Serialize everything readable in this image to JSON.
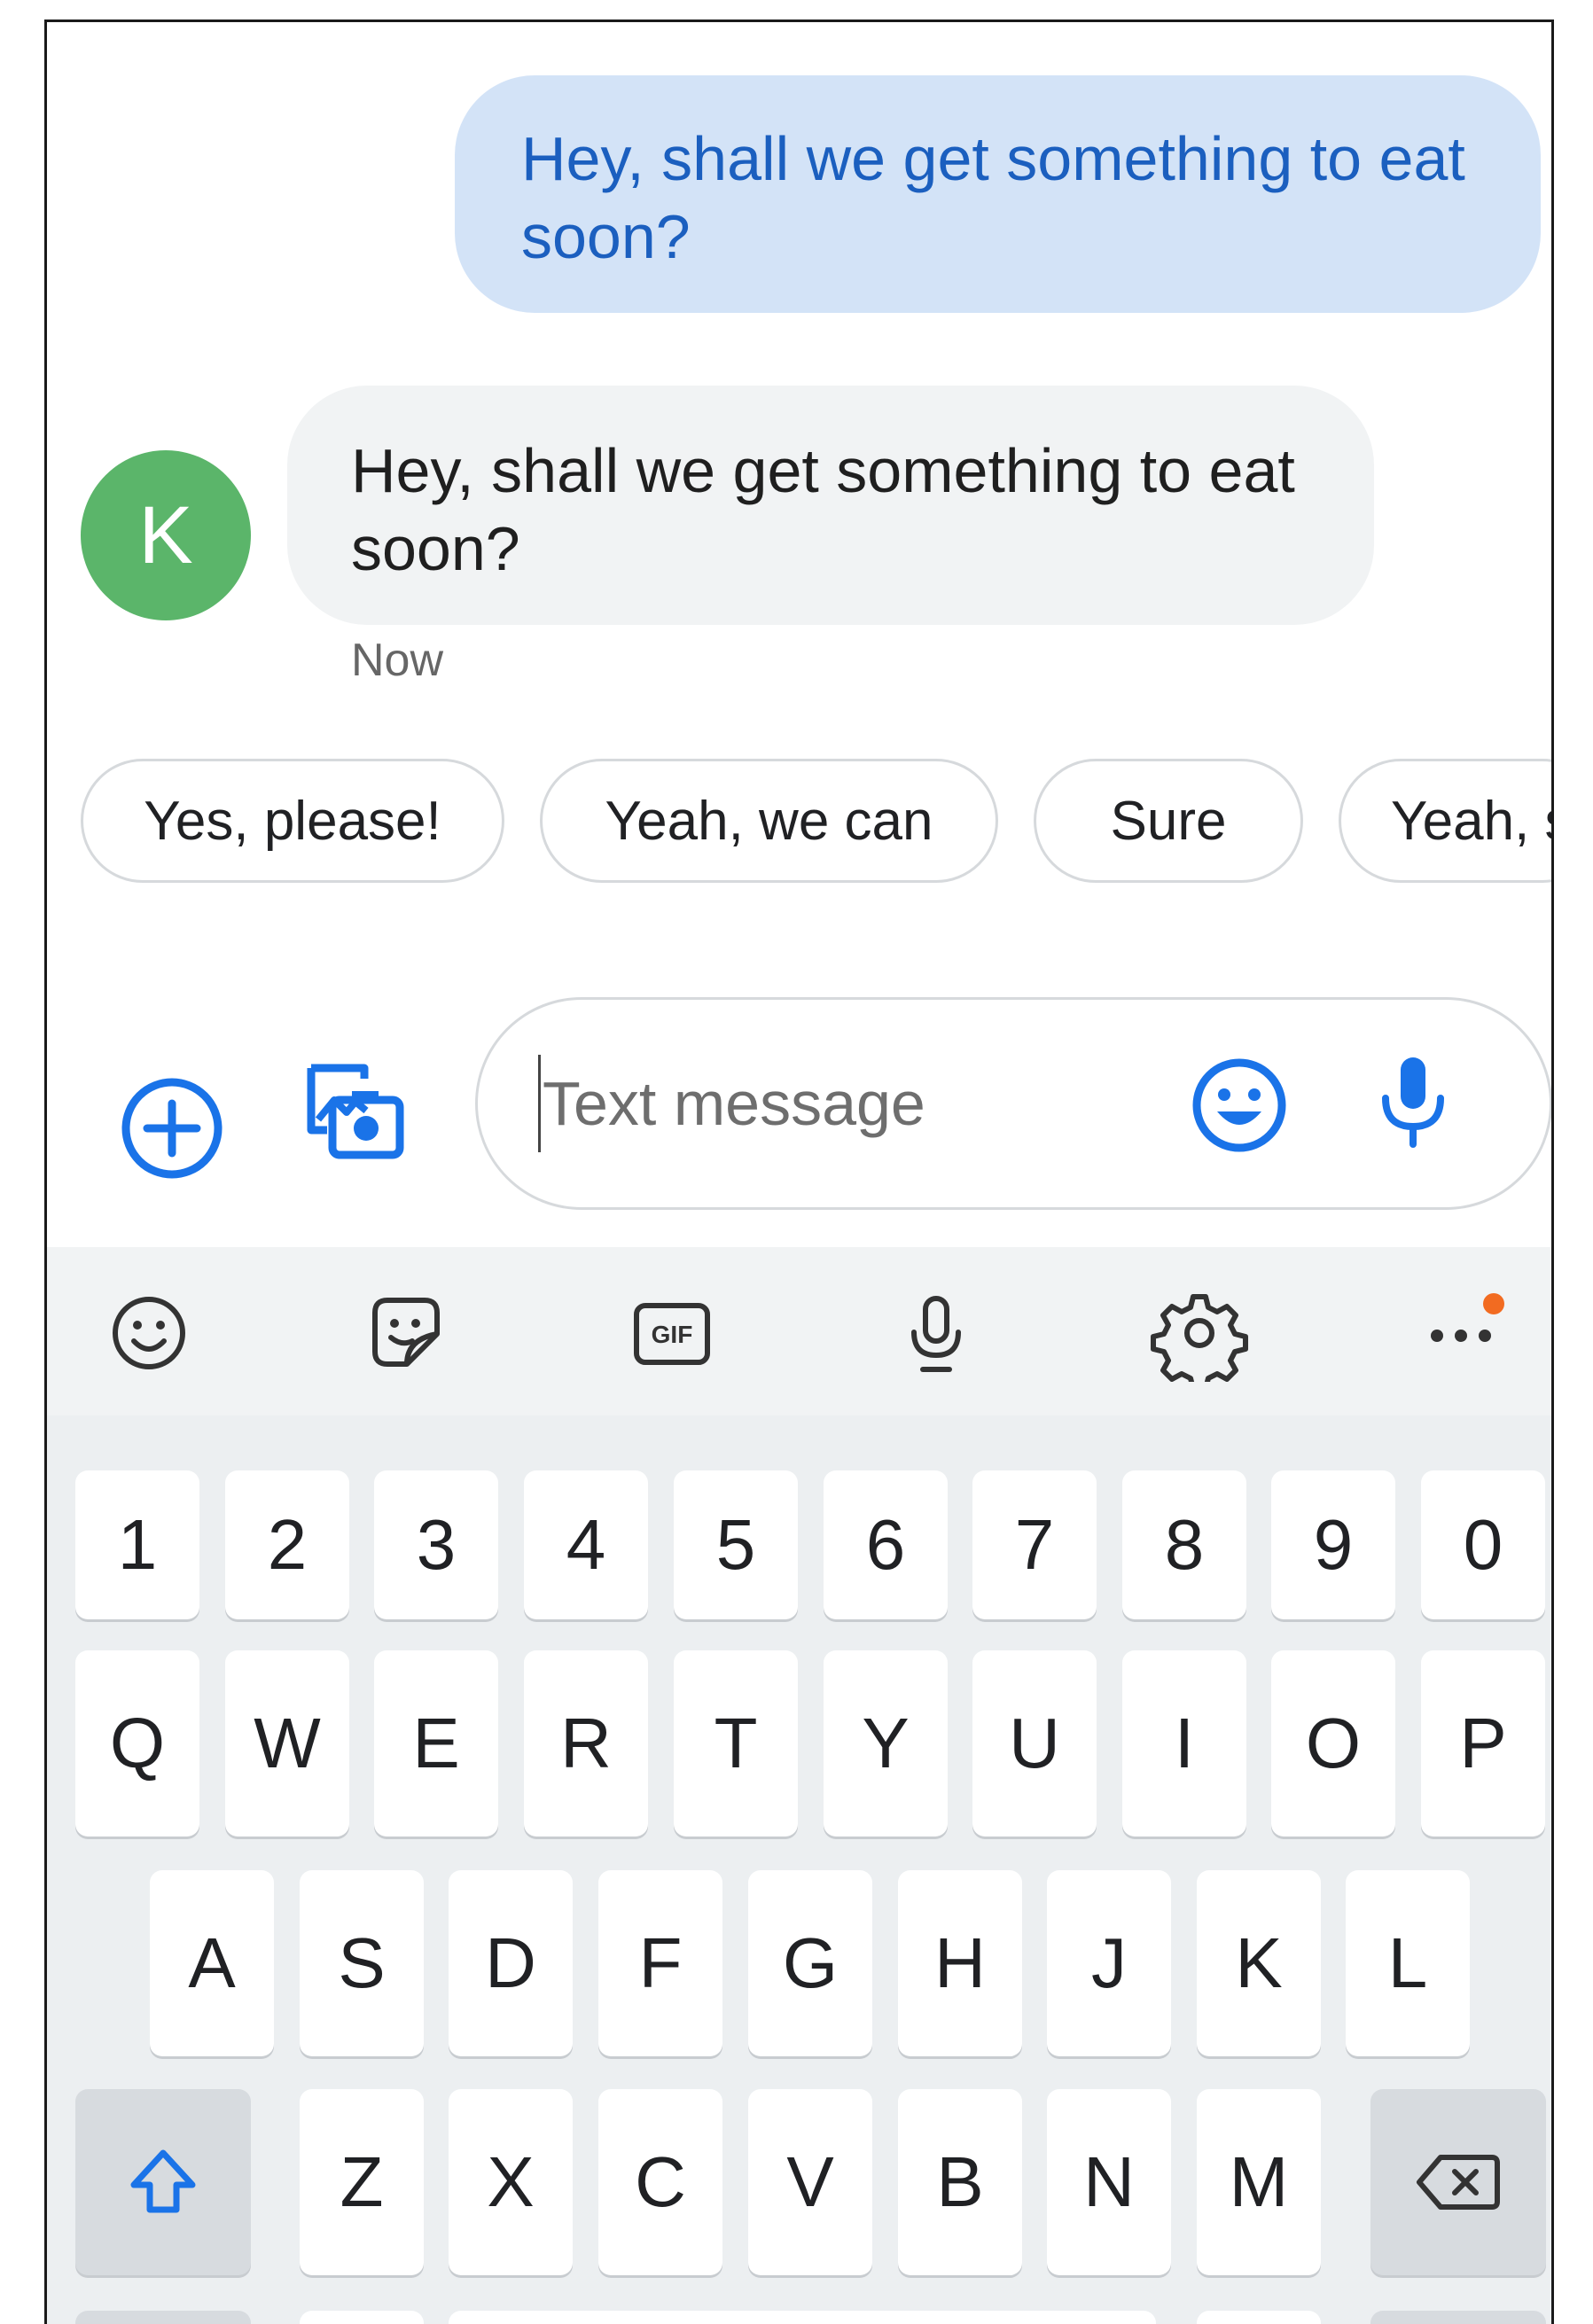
{
  "conversation": {
    "outgoing_message": "Hey, shall we get something to eat soon?",
    "incoming_message": "Hey, shall we get something to eat soon?",
    "contact_initial": "K",
    "timestamp": "Now"
  },
  "smart_replies": [
    "Yes, please!",
    "Yeah, we can",
    "Sure",
    "Yeah, s"
  ],
  "compose": {
    "placeholder": "Text message"
  },
  "keyboard": {
    "toolbar_icons": [
      "emoji-icon",
      "sticker-icon",
      "gif-icon",
      "microphone-icon",
      "settings-icon",
      "more-icon"
    ],
    "gif_label": "GIF",
    "number_row": [
      "1",
      "2",
      "3",
      "4",
      "5",
      "6",
      "7",
      "8",
      "9",
      "0"
    ],
    "row_1": [
      "Q",
      "W",
      "E",
      "R",
      "T",
      "Y",
      "U",
      "I",
      "O",
      "P"
    ],
    "row_2": [
      "A",
      "S",
      "D",
      "F",
      "G",
      "H",
      "J",
      "K",
      "L"
    ],
    "row_3": [
      "Z",
      "X",
      "C",
      "V",
      "B",
      "N",
      "M"
    ]
  },
  "colors": {
    "accent": "#1a73e8",
    "outgoing_bubble": "#d3e3f7",
    "incoming_bubble": "#f1f3f4",
    "avatar": "#5bb56a",
    "notification_dot": "#f26b21"
  }
}
